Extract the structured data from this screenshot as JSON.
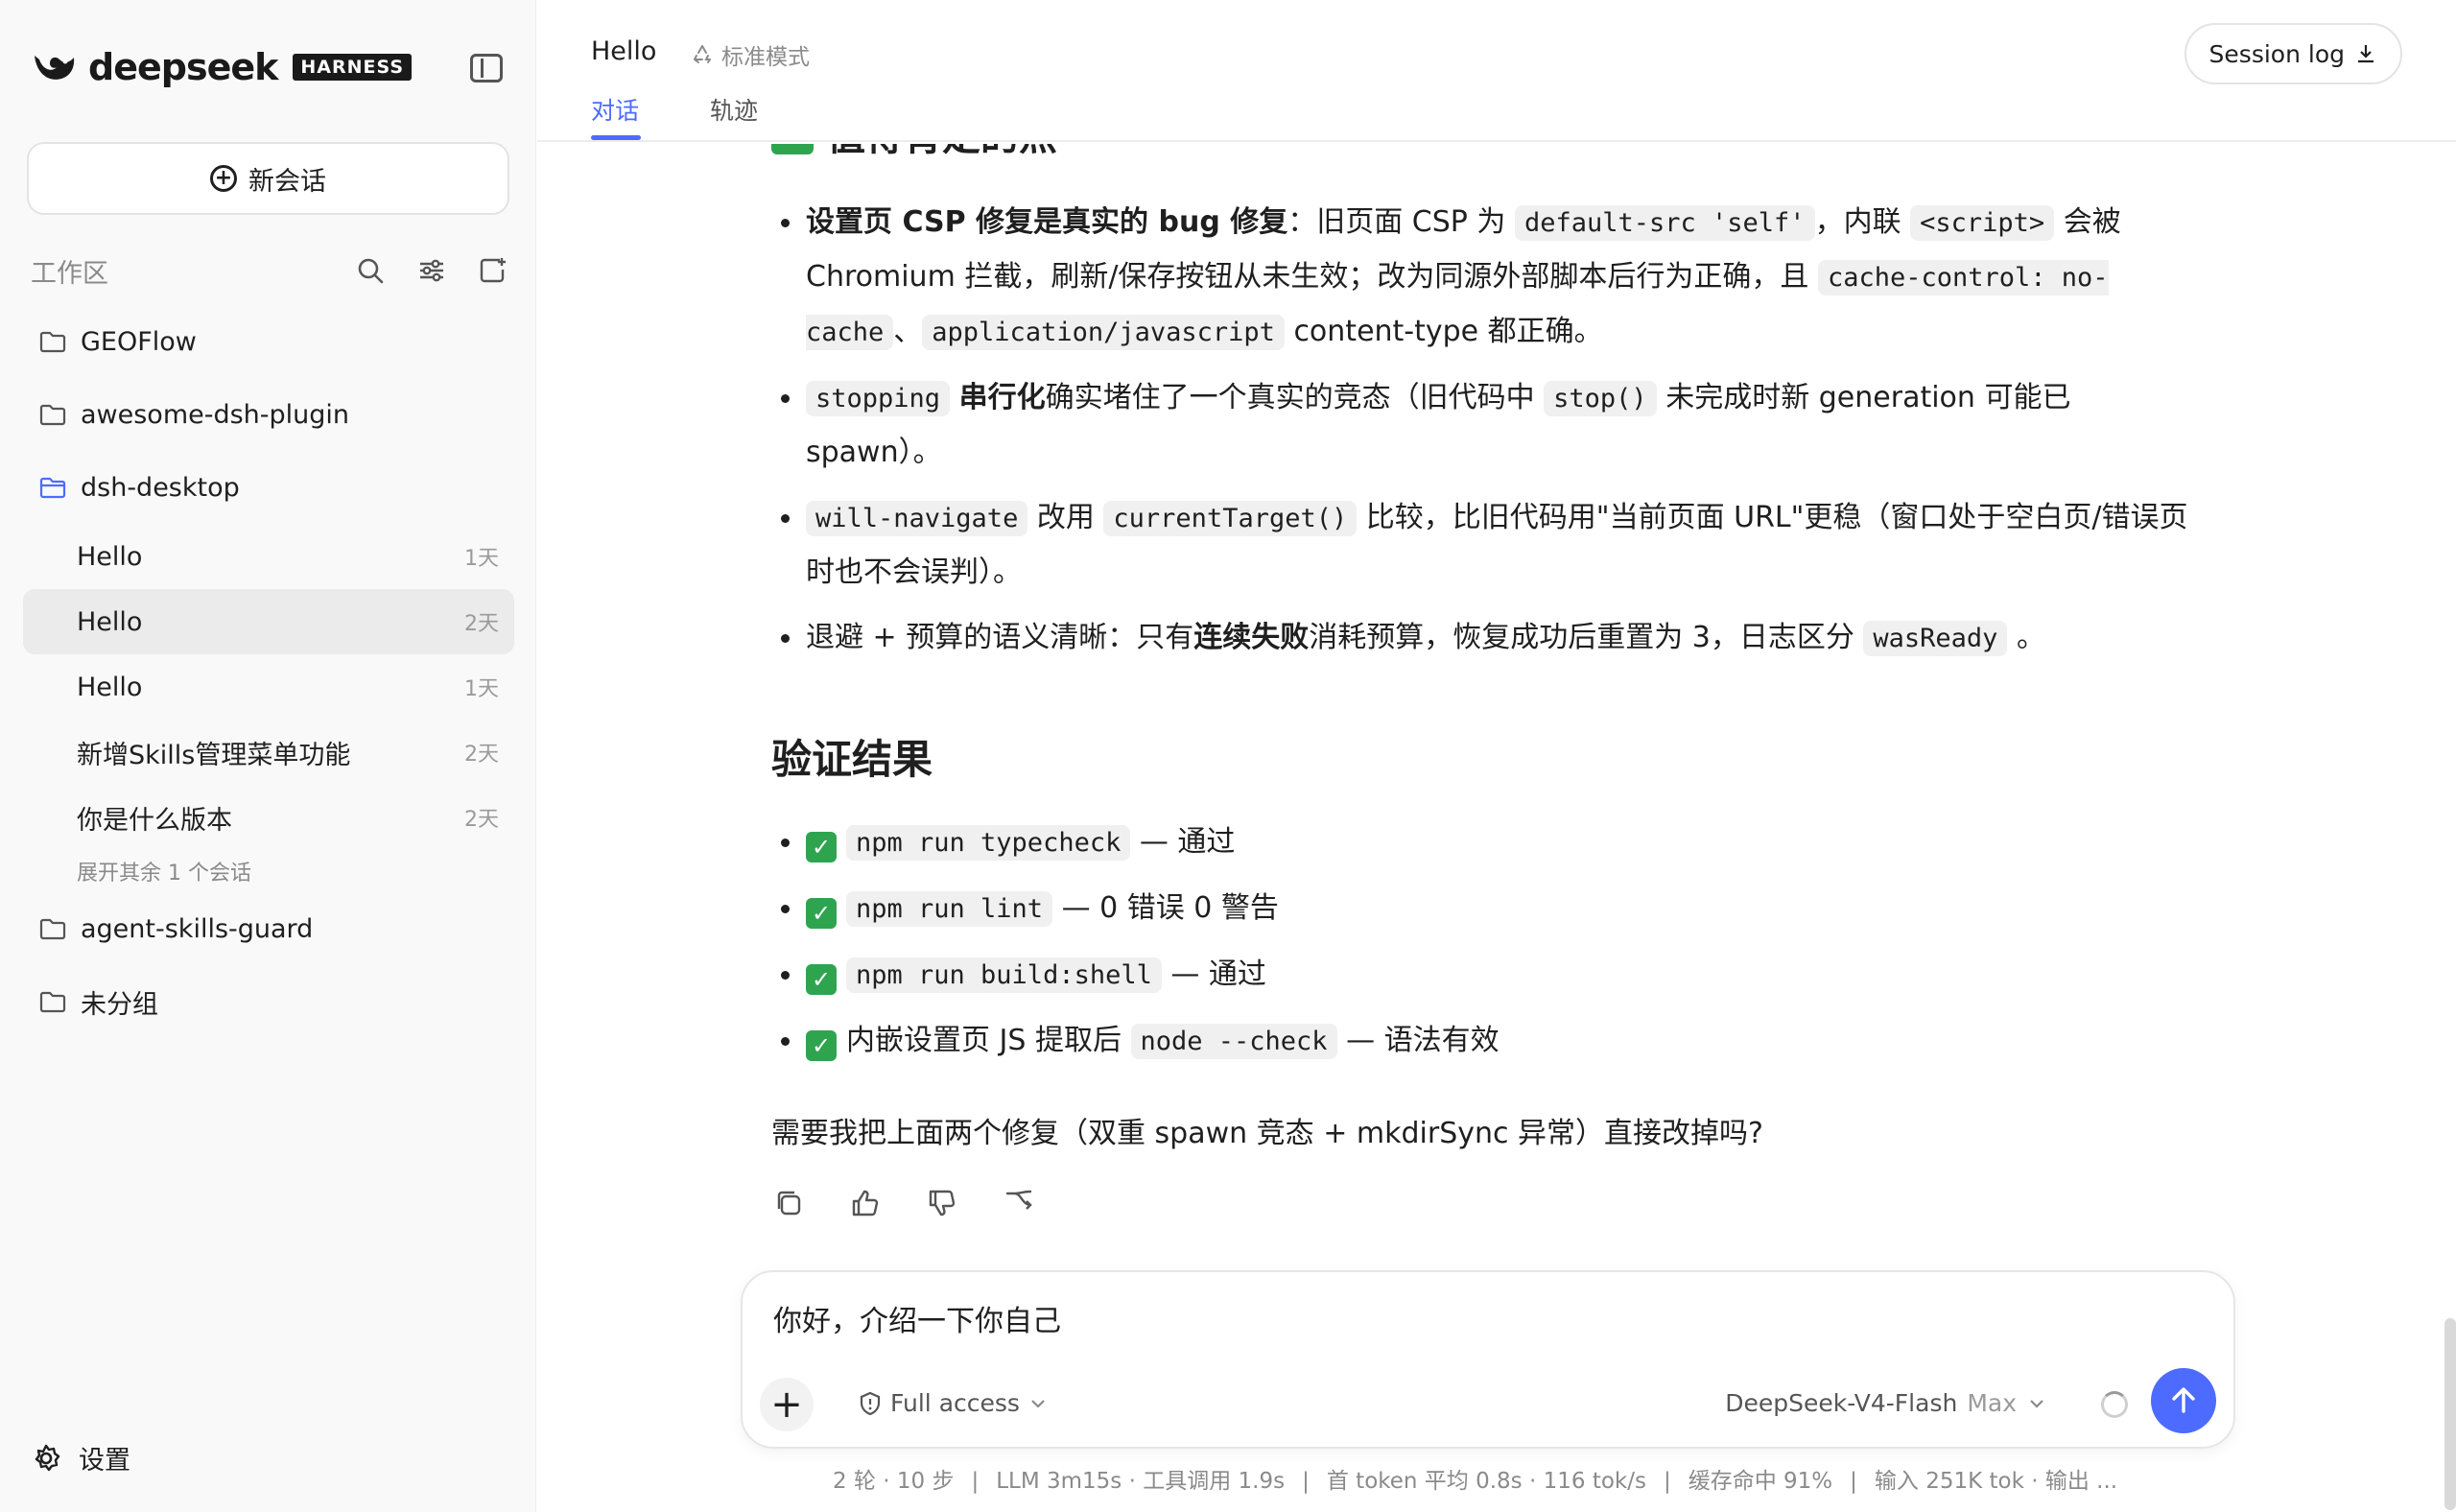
{
  "brand": {
    "name": "deepseek",
    "tag": "HARNESS"
  },
  "sidebar": {
    "new_chat": "新会话",
    "workspace_label": "工作区",
    "folders": [
      {
        "name": "GEOFlow"
      },
      {
        "name": "awesome-dsh-plugin"
      },
      {
        "name": "dsh-desktop",
        "open": true,
        "sessions": [
          {
            "title": "Hello",
            "age": "1天"
          },
          {
            "title": "Hello",
            "age": "2天",
            "active": true
          },
          {
            "title": "Hello",
            "age": "1天"
          },
          {
            "title": "新增Skills管理菜单功能",
            "age": "2天"
          },
          {
            "title": "你是什么版本",
            "age": "2天"
          }
        ],
        "expand_more": "展开其余 1 个会话"
      },
      {
        "name": "agent-skills-guard"
      },
      {
        "name": "未分组"
      }
    ],
    "settings": "设置"
  },
  "header": {
    "title": "Hello",
    "mode": "标准模式",
    "tabs": [
      "对话",
      "轨迹"
    ],
    "session_log": "Session log"
  },
  "content": {
    "partial_heading": "值得肯定的点",
    "points": [
      [
        {
          "t": "b",
          "v": "设置页 CSP 修复是真实的 bug 修复"
        },
        {
          "t": "s",
          "v": "：旧页面 CSP 为 "
        },
        {
          "t": "c",
          "v": "default-src 'self'"
        },
        {
          "t": "s",
          "v": "，内联 "
        },
        {
          "t": "c",
          "v": "<script>"
        },
        {
          "t": "s",
          "v": " 会被 Chromium 拦截，刷新/保存按钮从未生效；改为同源外部脚本后行为正确，且 "
        },
        {
          "t": "c",
          "v": "cache-control: no-cache"
        },
        {
          "t": "s",
          "v": "、"
        },
        {
          "t": "c",
          "v": "application/javascript"
        },
        {
          "t": "s",
          "v": " content-type 都正确。"
        }
      ],
      [
        {
          "t": "c",
          "v": "stopping"
        },
        {
          "t": "s",
          "v": " "
        },
        {
          "t": "b",
          "v": "串行化"
        },
        {
          "t": "s",
          "v": "确实堵住了一个真实的竞态（旧代码中 "
        },
        {
          "t": "c",
          "v": "stop()"
        },
        {
          "t": "s",
          "v": " 未完成时新 generation 可能已 spawn）。"
        }
      ],
      [
        {
          "t": "c",
          "v": "will-navigate"
        },
        {
          "t": "s",
          "v": " 改用 "
        },
        {
          "t": "c",
          "v": "currentTarget()"
        },
        {
          "t": "s",
          "v": " 比较，比旧代码用\"当前页面 URL\"更稳（窗口处于空白页/错误页时也不会误判）。"
        }
      ],
      [
        {
          "t": "s",
          "v": "退避 + 预算的语义清晰：只有"
        },
        {
          "t": "b",
          "v": "连续失败"
        },
        {
          "t": "s",
          "v": "消耗预算，恢复成功后重置为 3，日志区分 "
        },
        {
          "t": "c",
          "v": "wasReady"
        },
        {
          "t": "s",
          "v": " 。"
        }
      ]
    ],
    "section_title": "验证结果",
    "checks": [
      {
        "code": "npm run typecheck",
        "text": " — 通过"
      },
      {
        "pre": "",
        "code": "npm run lint",
        "text": " — 0 错误 0 警告"
      },
      {
        "pre": "",
        "code": "npm run build:shell",
        "text": " — 通过"
      },
      {
        "pre": "内嵌设置页 JS 提取后 ",
        "code": "node --check",
        "text": " — 语法有效"
      }
    ],
    "question": "需要我把上面两个修复（双重 spawn 竞态 + mkdirSync 异常）直接改掉吗?"
  },
  "composer": {
    "input_value": "你好，介绍一下你自己",
    "access": "Full access",
    "model": "DeepSeek-V4-Flash",
    "model_tier": "Max"
  },
  "status": {
    "items": [
      "2 轮 · 10 步",
      "LLM 3m15s · 工具调用 1.9s",
      "首 token 平均 0.8s · 116 tok/s",
      "缓存命中 91%",
      "输入 251K tok · 输出 ..."
    ],
    "separator": "|"
  },
  "colors": {
    "accent": "#4d6bfe",
    "check": "#2ea44f",
    "muted": "#8a8a8a"
  }
}
